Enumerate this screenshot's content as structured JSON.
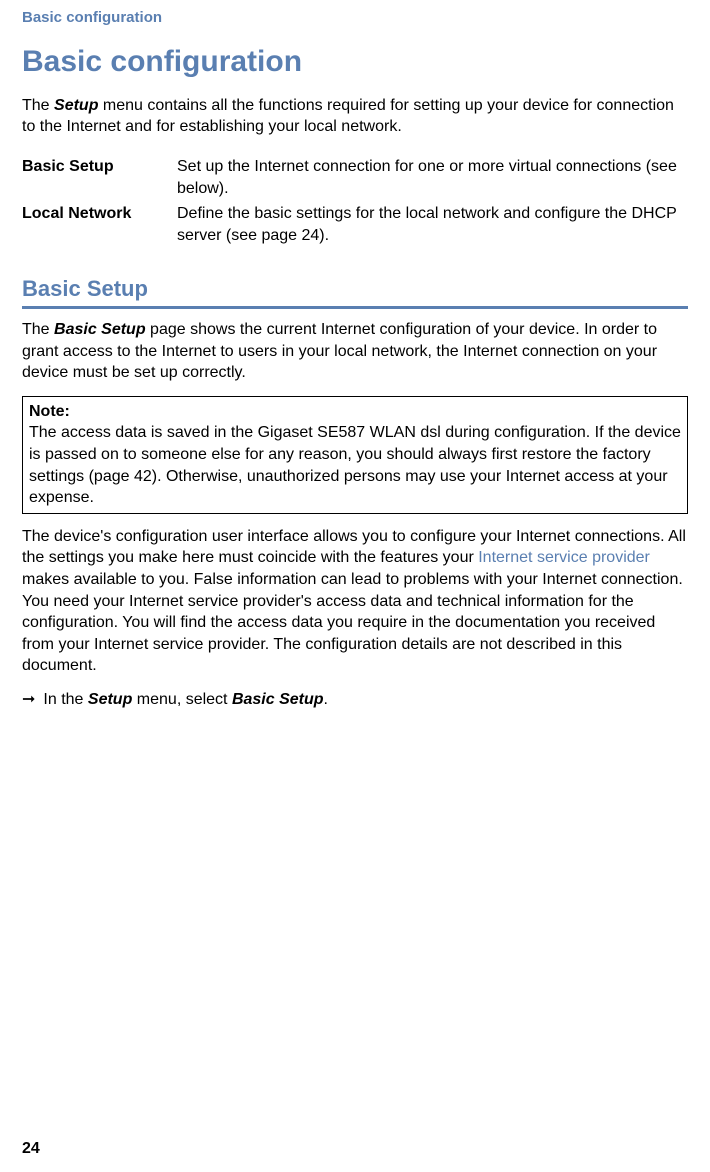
{
  "runningHeader": "Basic configuration",
  "chapterTitle": "Basic configuration",
  "intro": {
    "prefix": "The ",
    "setupWord": "Setup",
    "suffix": " menu contains all the functions required for setting up your device for connection to the Internet and for establishing your local network."
  },
  "defs": [
    {
      "term": "Basic Setup",
      "desc": "Set up the Internet connection for one or more virtual connections (see below)."
    },
    {
      "term": "Local Network",
      "desc": "Define the basic settings for the local network and configure the DHCP server (see page 24)."
    }
  ],
  "sectionHeading": "Basic Setup",
  "sectionIntro": {
    "prefix": "The ",
    "boldItalic": "Basic Setup",
    "suffix": " page shows the current Internet configuration of your device. In order to grant access to the Internet to users in your local network, the Internet connection on your device must be set up correctly."
  },
  "note": {
    "label": "Note:",
    "body": "The access data is saved in the Gigaset SE587 WLAN dsl during configuration. If the device is passed on to someone else for any reason, you should always first restore the factory settings (page 42). Otherwise, unauthorized persons may use your Internet access at your expense."
  },
  "configPara": {
    "part1": "The device's configuration user interface allows you to configure your Internet connections. All the settings you make here must coincide with the features your ",
    "link": "Internet service provider",
    "part2": " makes available to you. False information can lead to problems with your Internet connection. You need your Internet service provider's access data and technical information for the configuration. You will find the access data you require in the documentation you received from your Internet service provider. The configuration details are not described in this document."
  },
  "instruction": {
    "arrow": "➞",
    "p1": "In the ",
    "b1": "Setup",
    "p2": " menu, select ",
    "b2": "Basic Setup",
    "p3": "."
  },
  "pageNumber": "24"
}
